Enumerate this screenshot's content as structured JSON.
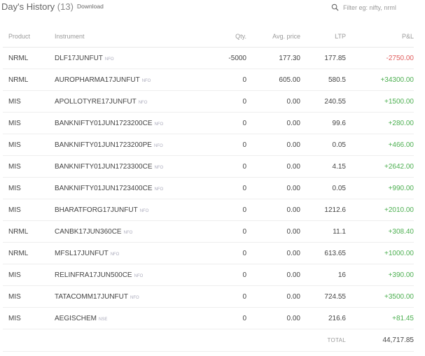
{
  "header": {
    "title": "Day's History",
    "count": "(13)",
    "download_label": "Download",
    "search_placeholder": "Filter eg: nifty, nrml"
  },
  "table": {
    "columns": {
      "product": "Product",
      "instrument": "Instrument",
      "qty": "Qty.",
      "avg_price": "Avg. price",
      "ltp": "LTP",
      "pnl": "P&L"
    },
    "rows": [
      {
        "product": "NRML",
        "instrument": "DLF17JUNFUT",
        "exchange": "NFO",
        "qty": "-5000",
        "avg_price": "177.30",
        "ltp": "177.85",
        "pnl": "-2750.00",
        "pnl_sign": "neg"
      },
      {
        "product": "NRML",
        "instrument": "AUROPHARMA17JUNFUT",
        "exchange": "NFO",
        "qty": "0",
        "avg_price": "605.00",
        "ltp": "580.5",
        "pnl": "+34300.00",
        "pnl_sign": "pos"
      },
      {
        "product": "MIS",
        "instrument": "APOLLOTYRE17JUNFUT",
        "exchange": "NFO",
        "qty": "0",
        "avg_price": "0.00",
        "ltp": "240.55",
        "pnl": "+1500.00",
        "pnl_sign": "pos"
      },
      {
        "product": "MIS",
        "instrument": "BANKNIFTY01JUN1723200CE",
        "exchange": "NFO",
        "qty": "0",
        "avg_price": "0.00",
        "ltp": "99.6",
        "pnl": "+280.00",
        "pnl_sign": "pos"
      },
      {
        "product": "MIS",
        "instrument": "BANKNIFTY01JUN1723200PE",
        "exchange": "NFO",
        "qty": "0",
        "avg_price": "0.00",
        "ltp": "0.05",
        "pnl": "+466.00",
        "pnl_sign": "pos"
      },
      {
        "product": "MIS",
        "instrument": "BANKNIFTY01JUN1723300CE",
        "exchange": "NFO",
        "qty": "0",
        "avg_price": "0.00",
        "ltp": "4.15",
        "pnl": "+2642.00",
        "pnl_sign": "pos"
      },
      {
        "product": "MIS",
        "instrument": "BANKNIFTY01JUN1723400CE",
        "exchange": "NFO",
        "qty": "0",
        "avg_price": "0.00",
        "ltp": "0.05",
        "pnl": "+990.00",
        "pnl_sign": "pos"
      },
      {
        "product": "MIS",
        "instrument": "BHARATFORG17JUNFUT",
        "exchange": "NFO",
        "qty": "0",
        "avg_price": "0.00",
        "ltp": "1212.6",
        "pnl": "+2010.00",
        "pnl_sign": "pos"
      },
      {
        "product": "NRML",
        "instrument": "CANBK17JUN360CE",
        "exchange": "NFO",
        "qty": "0",
        "avg_price": "0.00",
        "ltp": "11.1",
        "pnl": "+308.40",
        "pnl_sign": "pos"
      },
      {
        "product": "NRML",
        "instrument": "MFSL17JUNFUT",
        "exchange": "NFO",
        "qty": "0",
        "avg_price": "0.00",
        "ltp": "613.65",
        "pnl": "+1000.00",
        "pnl_sign": "pos"
      },
      {
        "product": "MIS",
        "instrument": "RELINFRA17JUN500CE",
        "exchange": "NFO",
        "qty": "0",
        "avg_price": "0.00",
        "ltp": "16",
        "pnl": "+390.00",
        "pnl_sign": "pos"
      },
      {
        "product": "MIS",
        "instrument": "TATACOMM17JUNFUT",
        "exchange": "NFO",
        "qty": "0",
        "avg_price": "0.00",
        "ltp": "724.55",
        "pnl": "+3500.00",
        "pnl_sign": "pos"
      },
      {
        "product": "MIS",
        "instrument": "AEGISCHEM",
        "exchange": "NSE",
        "qty": "0",
        "avg_price": "0.00",
        "ltp": "216.6",
        "pnl": "+81.45",
        "pnl_sign": "pos"
      }
    ],
    "total_label": "TOTAL",
    "total_value": "44,717.85"
  },
  "colors": {
    "positive": "#4caf50",
    "negative": "#e05d5d",
    "muted": "#999999"
  },
  "icons": {
    "search": "search-icon"
  }
}
